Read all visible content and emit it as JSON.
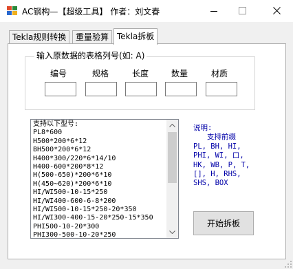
{
  "window": {
    "title": "AC钢构—【超级工具】 作者：刘文春"
  },
  "tabs": [
    {
      "label": "Tekla规则转换"
    },
    {
      "label": "重量验算"
    },
    {
      "label": "Tekla拆板"
    }
  ],
  "group": {
    "title": "输入原数据的表格列号(如: A)",
    "columns": [
      {
        "label": "编号",
        "value": ""
      },
      {
        "label": "规格",
        "value": ""
      },
      {
        "label": "长度",
        "value": ""
      },
      {
        "label": "数量",
        "value": ""
      },
      {
        "label": "材质",
        "value": ""
      }
    ]
  },
  "list": {
    "text": "支持以下型号:\nPL8*600\nH500*200*6*12\nBH500*200*6*12\nH400*300/220*6*14/10\nH400-600*200*8*12\nH(500-650)*200*6*10\nH(450~620)*200*6*10\nHI/WI500-10-15*250\nHI/WI400-600-6-8*200\nHI/WI500-10-15*250-20*350\nHI/WI300-400-15-20*250-15*350\nPHI500-10-20*300\nPHI300-500-10-20*250"
  },
  "note": {
    "heading": "说明:",
    "subheading": "支持前缀",
    "body": "PL, BH, HI,\nPHI, WI, 口,\nHK, WB, P, T,\n[], H, RHS,\nSHS, BOX"
  },
  "button": {
    "label": "开始拆板"
  },
  "colors": {
    "note_text": "#0000a8",
    "window_bg": "#f0f0f0"
  },
  "icons": [
    "app-icon",
    "minimize-icon",
    "maximize-icon",
    "close-icon",
    "scroll-up-icon",
    "scroll-down-icon",
    "resize-grip-icon"
  ]
}
